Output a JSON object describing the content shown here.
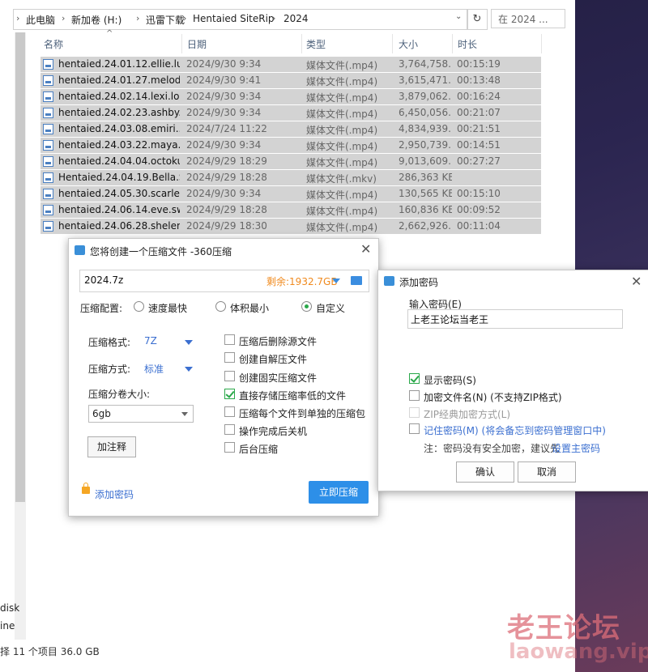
{
  "explorer": {
    "breadcrumb": [
      "此电脑",
      "新加卷 (H:)",
      "迅雷下载",
      "Hentaied SiteRip",
      "2024"
    ],
    "search_placeholder": "在 2024 ...",
    "columns": {
      "name": "名称",
      "date": "日期",
      "type": "类型",
      "size": "大小",
      "duration": "时长"
    },
    "files": [
      {
        "name": "hentaied.24.01.12.ellie.lu...",
        "date": "2024/9/30 9:34",
        "type": "媒体文件(.mp4)",
        "size": "3,764,758...",
        "duration": "00:15:19"
      },
      {
        "name": "hentaied.24.01.27.melod...",
        "date": "2024/9/30 9:41",
        "type": "媒体文件(.mp4)",
        "size": "3,615,471...",
        "duration": "00:13:48"
      },
      {
        "name": "hentaied.24.02.14.lexi.lor...",
        "date": "2024/9/30 9:34",
        "type": "媒体文件(.mp4)",
        "size": "3,879,062...",
        "duration": "00:16:24"
      },
      {
        "name": "hentaied.24.02.23.ashby....",
        "date": "2024/9/30 9:34",
        "type": "媒体文件(.mp4)",
        "size": "6,450,056...",
        "duration": "00:21:07"
      },
      {
        "name": "hentaied.24.03.08.emiri....",
        "date": "2024/7/24 11:22",
        "type": "媒体文件(.mp4)",
        "size": "4,834,939...",
        "duration": "00:21:51"
      },
      {
        "name": "hentaied.24.03.22.maya....",
        "date": "2024/9/30 9:34",
        "type": "媒体文件(.mp4)",
        "size": "2,950,739...",
        "duration": "00:14:51"
      },
      {
        "name": "hentaied.24.04.04.octoku...",
        "date": "2024/9/29 18:29",
        "type": "媒体文件(.mp4)",
        "size": "9,013,609...",
        "duration": "00:27:27"
      },
      {
        "name": "Hentaied.24.04.19.Bella.S...",
        "date": "2024/9/29 18:28",
        "type": "媒体文件(.mkv)",
        "size": "286,363 KB",
        "duration": ""
      },
      {
        "name": "hentaied.24.05.30.scarlet....",
        "date": "2024/9/30 9:34",
        "type": "媒体文件(.mp4)",
        "size": "130,565 KB",
        "duration": "00:15:10"
      },
      {
        "name": "hentaied.24.06.14.eve.sw...",
        "date": "2024/9/29 18:28",
        "type": "媒体文件(.mp4)",
        "size": "160,836 KB",
        "duration": "00:09:52"
      },
      {
        "name": "hentaied.24.06.28.shelen...",
        "date": "2024/9/29 18:30",
        "type": "媒体文件(.mp4)",
        "size": "2,662,926...",
        "duration": "00:11:04"
      }
    ],
    "status_left": "择 11 个项目  36.0 GB",
    "side_fragments": [
      "disk",
      "ine"
    ]
  },
  "compress_dialog": {
    "title": "您将创建一个压缩文件 -360压缩",
    "path_value": "2024.7z",
    "free_space": "剩余:1932.7GB",
    "config_label": "压缩配置:",
    "radios": [
      "速度最快",
      "体积最小",
      "自定义"
    ],
    "format_label": "压缩格式:",
    "format_value": "7Z",
    "method_label": "压缩方式:",
    "method_value": "标准",
    "volume_label": "压缩分卷大小:",
    "volume_value": "6gb",
    "comment_button": "加注释",
    "options": [
      {
        "label": "压缩后删除源文件",
        "checked": false
      },
      {
        "label": "创建自解压文件",
        "checked": false
      },
      {
        "label": "创建固实压缩文件",
        "checked": false
      },
      {
        "label": "直接存储压缩率低的文件",
        "checked": true
      },
      {
        "label": "压缩每个文件到单独的压缩包",
        "checked": false
      },
      {
        "label": "操作完成后关机",
        "checked": false
      },
      {
        "label": "后台压缩",
        "checked": false
      }
    ],
    "add_password_link": "添加密码",
    "compress_button": "立即压缩"
  },
  "password_dialog": {
    "title": "添加密码",
    "input_label": "输入密码(E)",
    "password_value": "上老王论坛当老王",
    "show_password": "显示密码(S)",
    "encrypt_names": "加密文件名(N) (不支持ZIP格式)",
    "zip_classic": "ZIP经典加密方式(L)",
    "remember_password": "记住密码(M) (将会备忘到密码管理窗口中)",
    "note_prefix": "注：密码没有安全加密，建议先",
    "note_link": "设置主密码",
    "ok_button": "确认",
    "cancel_button": "取消"
  },
  "watermark": {
    "line1": "老王论坛",
    "line2": "laowang.vip"
  }
}
